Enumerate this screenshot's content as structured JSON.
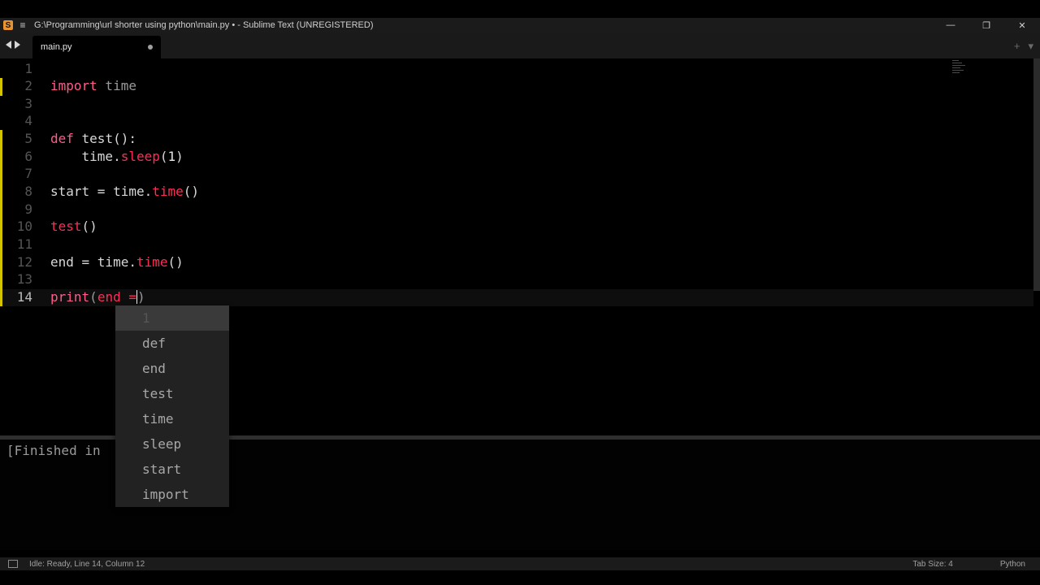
{
  "window": {
    "title": "G:\\Programming\\url shorter using python\\main.py • - Sublime Text (UNREGISTERED)",
    "app_icon_glyph": "S",
    "controls": [
      "minimize-icon",
      "restore-icon",
      "close-icon"
    ]
  },
  "tabs": [
    {
      "label": "main.py",
      "dirty": true
    }
  ],
  "editor": {
    "line_numbers": [
      "1",
      "2",
      "3",
      "4",
      "5",
      "6",
      "7",
      "8",
      "9",
      "10",
      "11",
      "12",
      "13",
      "14"
    ],
    "active_line": 14,
    "lines": {
      "l2_kw": "import",
      "l2_rest": " time",
      "l5_kw": "def",
      "l5_rest": " test():",
      "l6_indent": "    ",
      "l6_obj": "time.",
      "l6_fn": "sleep",
      "l6_open": "(",
      "l6_num": "1",
      "l6_close": ")",
      "l8_a": "start = time.",
      "l8_fn": "time",
      "l8_b": "()",
      "l10_fn": "test",
      "l10_b": "()",
      "l12_a": "end = time.",
      "l12_fn": "time",
      "l12_b": "()",
      "l14_kw": "print",
      "l14_open": "(",
      "l14_a": "end =",
      "l14_close": ")"
    }
  },
  "autocomplete": {
    "items": [
      "1",
      "def",
      "end",
      "test",
      "time",
      "sleep",
      "start",
      "import"
    ],
    "selected_index": 0
  },
  "output": {
    "text": "[Finished in"
  },
  "status": {
    "left": "Idle: Ready, Line 14, Column 12",
    "tab_size": "Tab Size: 4",
    "syntax": "Python"
  },
  "colors": {
    "keyword": "#ff5c8a",
    "function": "#ff2d55",
    "modified_marker": "#d4c400"
  }
}
